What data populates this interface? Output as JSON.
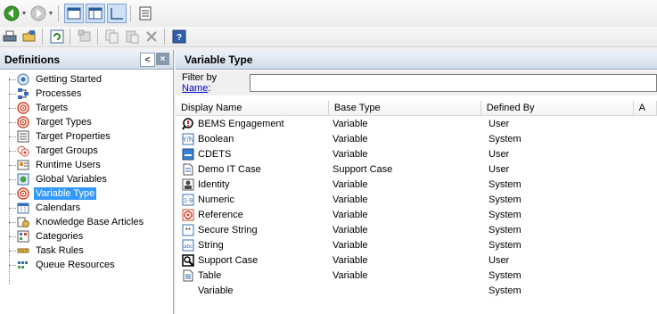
{
  "toolbar": {
    "row1": [
      "back-icon",
      "forward-icon",
      "view-large-icon",
      "view-details-icon",
      "view-chart-icon",
      "properties-list-icon"
    ],
    "row2": [
      "print-icon",
      "open-folder-icon",
      "refresh-icon",
      "move-icon",
      "copy-icon",
      "paste-icon",
      "delete-icon",
      "help-icon"
    ]
  },
  "left": {
    "title": "Definitions",
    "collapse_glyph": "<",
    "close_glyph": "×",
    "items": [
      {
        "label": "Getting Started",
        "icon": "getting-started-icon"
      },
      {
        "label": "Processes",
        "icon": "processes-icon"
      },
      {
        "label": "Targets",
        "icon": "target-icon"
      },
      {
        "label": "Target Types",
        "icon": "target-icon"
      },
      {
        "label": "Target Properties",
        "icon": "target-properties-icon"
      },
      {
        "label": "Target Groups",
        "icon": "target-groups-icon"
      },
      {
        "label": "Runtime Users",
        "icon": "runtime-users-icon"
      },
      {
        "label": "Global Variables",
        "icon": "global-variables-icon"
      },
      {
        "label": "Variable Type",
        "icon": "target-icon",
        "selected": true
      },
      {
        "label": "Calendars",
        "icon": "calendar-icon"
      },
      {
        "label": "Knowledge Base Articles",
        "icon": "knowledge-base-icon"
      },
      {
        "label": "Categories",
        "icon": "categories-icon"
      },
      {
        "label": "Task Rules",
        "icon": "task-rules-icon"
      },
      {
        "label": "Queue Resources",
        "icon": "queue-resources-icon"
      }
    ]
  },
  "right": {
    "title": "Variable Type",
    "filter_prefix": "Filter by ",
    "filter_link": "Name",
    "filter_suffix": ":",
    "filter_value": "",
    "columns": [
      "Display Name",
      "Base Type",
      "Defined By",
      "A"
    ],
    "rows": [
      {
        "name": "BEMS Engagement",
        "base": "Variable",
        "defined": "User",
        "icon": "bems-icon"
      },
      {
        "name": "Boolean",
        "base": "Variable",
        "defined": "System",
        "icon": "boolean-icon"
      },
      {
        "name": "CDETS",
        "base": "Variable",
        "defined": "User",
        "icon": "cdets-icon"
      },
      {
        "name": "Demo IT Case",
        "base": "Support Case",
        "defined": "User",
        "icon": "document-icon"
      },
      {
        "name": "Identity",
        "base": "Variable",
        "defined": "System",
        "icon": "identity-icon"
      },
      {
        "name": "Numeric",
        "base": "Variable",
        "defined": "System",
        "icon": "numeric-icon"
      },
      {
        "name": "Reference",
        "base": "Variable",
        "defined": "System",
        "icon": "reference-icon"
      },
      {
        "name": "Secure String",
        "base": "Variable",
        "defined": "System",
        "icon": "secure-string-icon"
      },
      {
        "name": "String",
        "base": "Variable",
        "defined": "System",
        "icon": "string-icon"
      },
      {
        "name": "Support Case",
        "base": "Variable",
        "defined": "User",
        "icon": "support-case-icon"
      },
      {
        "name": "Table",
        "base": "Variable",
        "defined": "System",
        "icon": "table-icon"
      },
      {
        "name": "Variable",
        "base": "",
        "defined": "System",
        "icon": "variable-icon"
      }
    ]
  },
  "colors": {
    "selection": "#3399ff",
    "header_gradient_bottom": "#d2dce9",
    "link": "#0000cc"
  }
}
